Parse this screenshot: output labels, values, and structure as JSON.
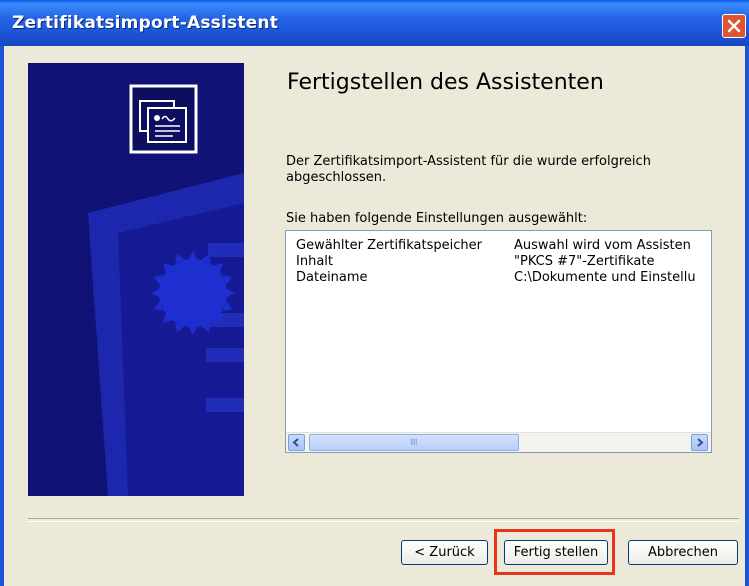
{
  "window": {
    "title": "Zertifikatsimport-Assistent"
  },
  "main": {
    "heading": "Fertigstellen des Assistenten",
    "description": "Der Zertifikatsimport-Assistent für die wurde erfolgreich abgeschlossen.",
    "settings_label": "Sie haben folgende Einstellungen ausgewählt:",
    "settings": [
      {
        "key": "Gewählter Zertifikatspeicher",
        "value": "Auswahl wird vom Assisten"
      },
      {
        "key": "Inhalt",
        "value": "\"PKCS #7\"-Zertifikate"
      },
      {
        "key": "Dateiname",
        "value": "C:\\Dokumente und Einstellu"
      }
    ],
    "scrollbar_grip": "IIII"
  },
  "buttons": {
    "back": "< Zurück",
    "finish": "Fertig stellen",
    "cancel": "Abbrechen"
  },
  "colors": {
    "titlebar": "#1C55D8",
    "highlight": "#E8331D",
    "side_panel": "#11127A"
  }
}
